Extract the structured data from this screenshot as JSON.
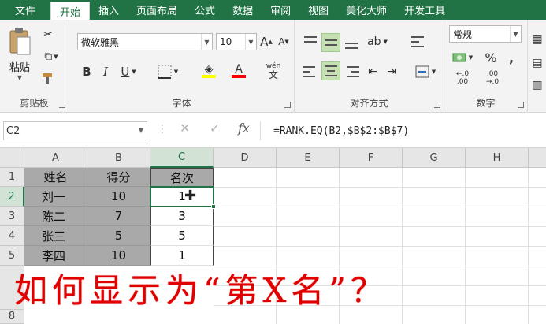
{
  "ribbon_tabs": [
    "文件",
    "开始",
    "插入",
    "页面布局",
    "公式",
    "数据",
    "审阅",
    "视图",
    "美化大师",
    "开发工具"
  ],
  "active_tab": "开始",
  "clipboard": {
    "paste_label": "粘贴",
    "group_label": "剪贴板"
  },
  "font": {
    "name": "微软雅黑",
    "size": "10",
    "group_label": "字体",
    "bold": "B",
    "italic": "I",
    "underline": "U",
    "grow": "A",
    "shrink": "A",
    "font_color": "A",
    "phonetic_top": "wén",
    "phonetic_bottom": "文",
    "highlight_color": "#ffff00",
    "text_color": "#ff0000"
  },
  "alignment": {
    "group_label": "对齐方式"
  },
  "number": {
    "format": "常规",
    "group_label": "数字",
    "percent": "%",
    "comma": ",",
    "inc_decimal_top": "←.0",
    "inc_decimal_bottom": ".00",
    "dec_decimal_top": ".00",
    "dec_decimal_bottom": "→.0"
  },
  "formula_bar": {
    "name_box": "C2",
    "fx": "fx",
    "cancel": "✕",
    "confirm": "✓",
    "formula": "=RANK.EQ(B2,$B$2:$B$7)"
  },
  "columns": [
    "A",
    "B",
    "C",
    "D",
    "E",
    "F",
    "G",
    "H"
  ],
  "rows": [
    "1",
    "2",
    "3",
    "4",
    "5",
    "8"
  ],
  "table": {
    "headers": [
      "姓名",
      "得分",
      "名次"
    ],
    "rows": [
      {
        "name": "刘一",
        "score": "10",
        "rank": "1"
      },
      {
        "name": "陈二",
        "score": "7",
        "rank": "3"
      },
      {
        "name": "张三",
        "score": "5",
        "rank": "5"
      },
      {
        "name": "李四",
        "score": "10",
        "rank": "1"
      }
    ]
  },
  "overlay_text": "如何显示为“第X名”？",
  "accent_color": "#217346"
}
